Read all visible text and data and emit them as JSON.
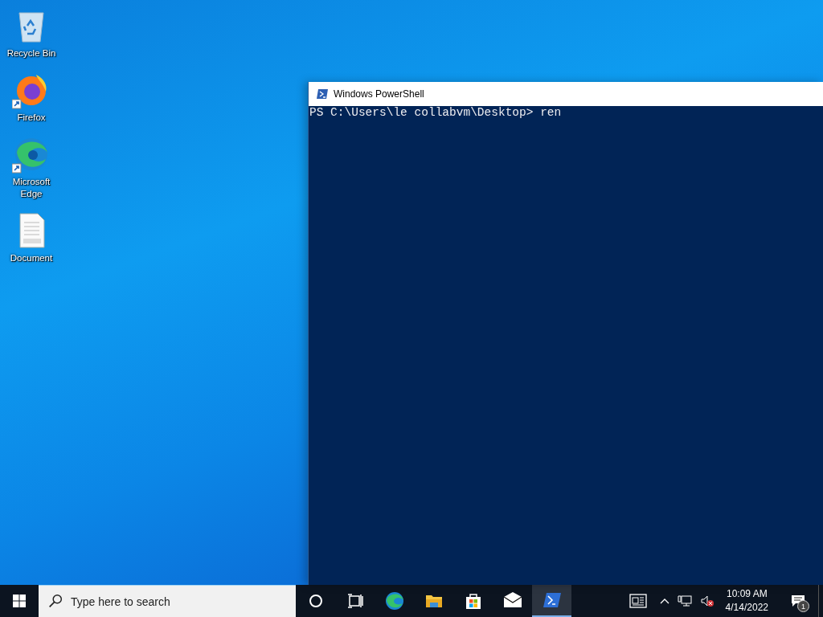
{
  "desktop_icons": [
    {
      "kind": "recycle",
      "label": "Recycle Bin",
      "shortcut": false
    },
    {
      "kind": "firefox",
      "label": "Firefox",
      "shortcut": true
    },
    {
      "kind": "edge",
      "label": "Microsoft Edge",
      "shortcut": true
    },
    {
      "kind": "docx",
      "label": "Document",
      "shortcut": false
    }
  ],
  "window": {
    "title": "Windows PowerShell",
    "console_lines": [
      "PS C:\\Users\\le collabvm\\Desktop> ren"
    ]
  },
  "taskbar": {
    "search": {
      "placeholder": "Type here to search"
    },
    "apps": [
      {
        "kind": "cortana",
        "selected": false
      },
      {
        "kind": "taskview",
        "selected": false
      },
      {
        "kind": "edge",
        "selected": false
      },
      {
        "kind": "explorer",
        "selected": false
      },
      {
        "kind": "store",
        "selected": false
      },
      {
        "kind": "mail",
        "selected": false
      },
      {
        "kind": "powershell",
        "selected": true
      }
    ],
    "clock": {
      "time": "10:09 AM",
      "date": "4/14/2022"
    },
    "notifications": {
      "count": "1"
    }
  }
}
